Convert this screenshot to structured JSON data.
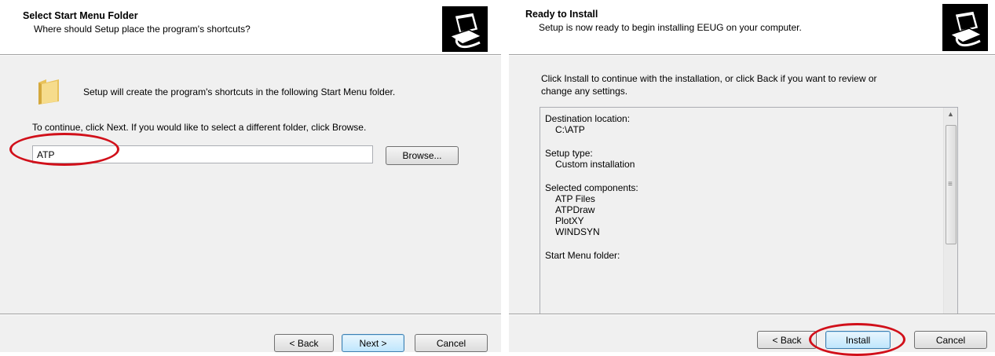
{
  "left": {
    "header": {
      "title": "Select Start Menu Folder",
      "subtitle": "Where should Setup place the program's shortcuts?"
    },
    "body": {
      "info_text": "Setup will create the program's shortcuts in the following Start Menu folder.",
      "instruction_text": "To continue, click Next. If you would like to select a different folder, click Browse.",
      "folder_value": "ATP",
      "browse_label": "Browse..."
    },
    "footer": {
      "back_label": "< Back",
      "next_label": "Next >",
      "cancel_label": "Cancel"
    }
  },
  "right": {
    "header": {
      "title": "Ready to Install",
      "subtitle": "Setup is now ready to begin installing EEUG on your computer."
    },
    "body": {
      "instruction_line1": "Click Install to continue with the installation, or click Back if you want to review or",
      "instruction_line2": "change any settings.",
      "memo": {
        "destination_label": "Destination location:",
        "destination_value": "C:\\ATP",
        "setup_type_label": "Setup type:",
        "setup_type_value": "Custom installation",
        "components_label": "Selected components:",
        "components": [
          "ATP Files",
          "ATPDraw",
          "PlotXY",
          "WINDSYN"
        ],
        "start_menu_label": "Start Menu folder:"
      }
    },
    "footer": {
      "back_label": "< Back",
      "install_label": "Install",
      "cancel_label": "Cancel"
    }
  },
  "icons": [
    "setup-logo-icon",
    "folder-icon",
    "scroll-up-arrow-icon",
    "scroll-down-arrow-icon",
    "scroll-left-arrow-icon",
    "scroll-right-arrow-icon",
    "scroll-grip-icon"
  ],
  "colors": {
    "highlight_oval": "#d1101a",
    "dialog_background": "#f0f0f0",
    "default_button_border": "#3c7fb1"
  }
}
